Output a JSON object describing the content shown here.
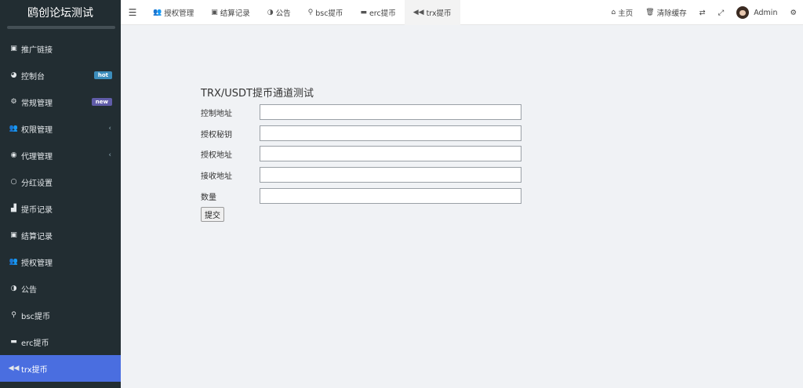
{
  "sidebar": {
    "brand": "鸥创论坛测试",
    "items": [
      {
        "label": "推广链接",
        "icon": "image-icon",
        "glyph": "▣"
      },
      {
        "label": "控制台",
        "icon": "dashboard-icon",
        "glyph": "◕",
        "badge": "hot"
      },
      {
        "label": "常规管理",
        "icon": "cogs-icon",
        "glyph": "⚙",
        "badge": "new"
      },
      {
        "label": "权限管理",
        "icon": "group-icon",
        "glyph": "👥",
        "chevron": "‹"
      },
      {
        "label": "代理管理",
        "icon": "user-circle-icon",
        "glyph": "◉",
        "chevron": "‹"
      },
      {
        "label": "分红设置",
        "icon": "circle-icon",
        "glyph": "○"
      },
      {
        "label": "提币记录",
        "icon": "bank-icon",
        "glyph": "▟"
      },
      {
        "label": "结算记录",
        "icon": "image-icon",
        "glyph": "▣"
      },
      {
        "label": "授权管理",
        "icon": "group-icon",
        "glyph": "👥"
      },
      {
        "label": "公告",
        "icon": "adjust-icon",
        "glyph": "◑"
      },
      {
        "label": "bsc提币",
        "icon": "bicycle-icon",
        "glyph": "⚲"
      },
      {
        "label": "erc提币",
        "icon": "briefcase-icon",
        "glyph": "▬"
      },
      {
        "label": "trx提币",
        "icon": "backward-icon",
        "glyph": "◀◀",
        "active": true
      }
    ]
  },
  "topbar": {
    "tabs": [
      {
        "label": "授权管理",
        "icon": "group-icon",
        "glyph": "👥"
      },
      {
        "label": "结算记录",
        "icon": "image-icon",
        "glyph": "▣"
      },
      {
        "label": "公告",
        "icon": "adjust-icon",
        "glyph": "◑"
      },
      {
        "label": "bsc提币",
        "icon": "bicycle-icon",
        "glyph": "⚲"
      },
      {
        "label": "erc提币",
        "icon": "briefcase-icon",
        "glyph": "▬"
      },
      {
        "label": "trx提币",
        "icon": "backward-icon",
        "glyph": "◀◀",
        "active": true
      }
    ],
    "right": {
      "home_label": "主页",
      "clear_cache_label": "清除缓存",
      "user_name": "Admin"
    }
  },
  "form": {
    "title": "TRX/USDT提币通道测试",
    "fields": [
      {
        "label": "控制地址",
        "value": ""
      },
      {
        "label": "授权秘钥",
        "value": ""
      },
      {
        "label": "授权地址",
        "value": ""
      },
      {
        "label": "接收地址",
        "value": ""
      },
      {
        "label": "数量",
        "value": ""
      }
    ],
    "submit_label": "提交"
  },
  "colors": {
    "sidebar_bg": "#222d32",
    "active_item": "#4a6ee0",
    "page_bg": "#f0f2f5",
    "badge_hot": "#3c8dbc",
    "badge_new": "#605ca8"
  }
}
